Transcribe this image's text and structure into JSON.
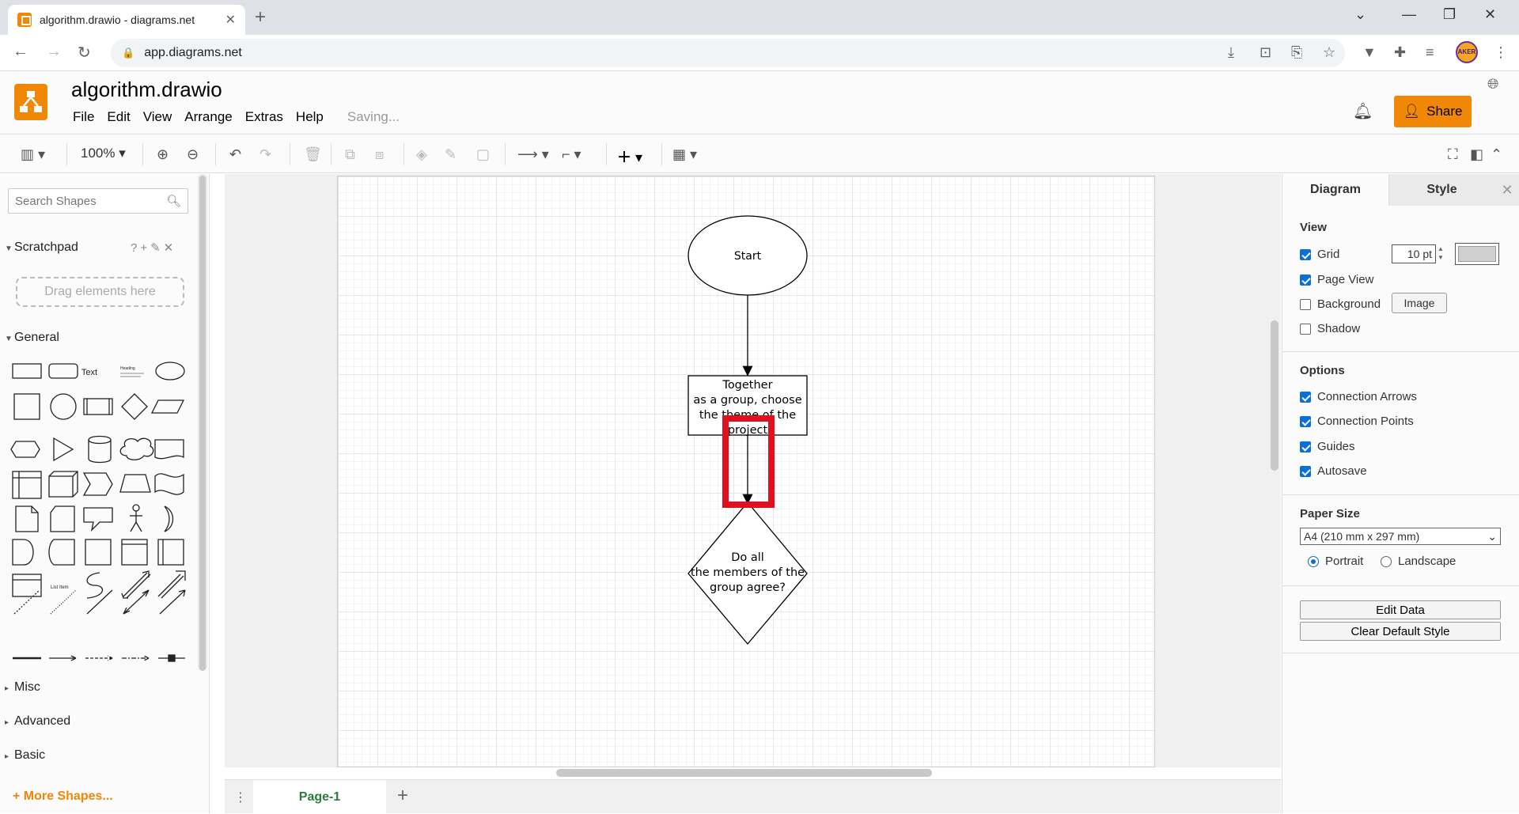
{
  "browser": {
    "tab_title": "algorithm.drawio - diagrams.net",
    "url": "app.diagrams.net",
    "profile_text": "AKER"
  },
  "app": {
    "filename": "algorithm.drawio",
    "menu": [
      "File",
      "Edit",
      "View",
      "Arrange",
      "Extras",
      "Help"
    ],
    "status": "Saving...",
    "share_label": "Share",
    "accent": "#f08705"
  },
  "toolbar": {
    "zoom": "100%"
  },
  "sidebar": {
    "search_placeholder": "Search Shapes",
    "scratchpad": "Scratchpad",
    "drag_hint": "Drag elements here",
    "general": "General",
    "shape_text_label": "Text",
    "shape_heading_label": "Heading",
    "shape_list_item_label": "List Item",
    "sections": [
      "Misc",
      "Advanced",
      "Basic"
    ],
    "more_shapes": "More Shapes..."
  },
  "diagram": {
    "start": "Start",
    "step1_lines": [
      "Together",
      "as a group, choose",
      "the theme of the",
      "project"
    ],
    "decision_lines": [
      "Do all",
      "the members of the",
      "group agree?"
    ],
    "highlight_color": "#e0101e"
  },
  "pages": {
    "current": "Page-1"
  },
  "format_panel": {
    "tab_diagram": "Diagram",
    "tab_style": "Style",
    "view_head": "View",
    "grid": "Grid",
    "grid_size": "10 pt",
    "page_view": "Page View",
    "background": "Background",
    "image_btn": "Image",
    "shadow": "Shadow",
    "options_head": "Options",
    "connection_arrows": "Connection Arrows",
    "connection_points": "Connection Points",
    "guides": "Guides",
    "autosave": "Autosave",
    "paper_head": "Paper Size",
    "paper_size": "A4 (210 mm x 297 mm)",
    "portrait": "Portrait",
    "landscape": "Landscape",
    "edit_data": "Edit Data",
    "clear_style": "Clear Default Style"
  }
}
